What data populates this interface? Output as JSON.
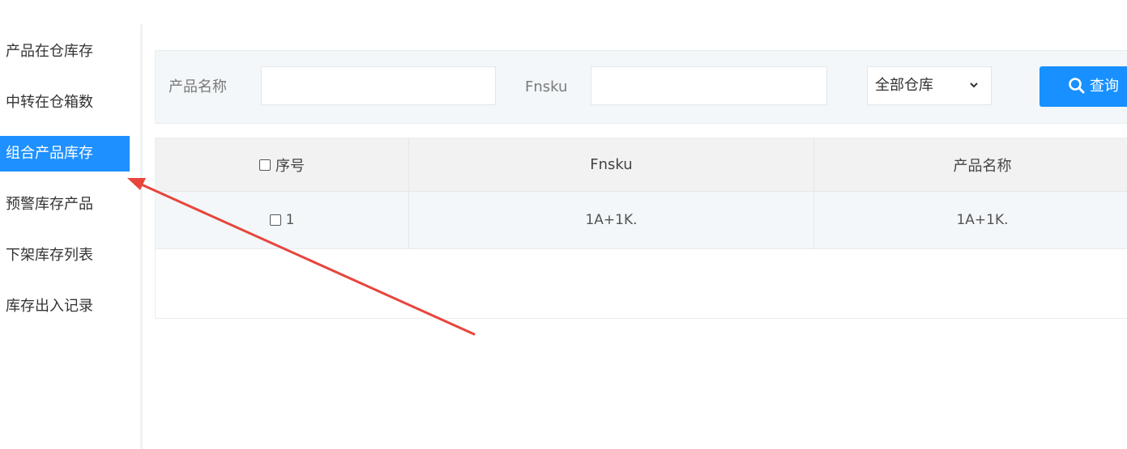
{
  "sidebar": {
    "items": [
      {
        "label": "产品在仓库存"
      },
      {
        "label": "中转在仓箱数"
      },
      {
        "label": "组合产品库存"
      },
      {
        "label": "预警库存产品"
      },
      {
        "label": "下架库存列表"
      },
      {
        "label": "库存出入记录"
      }
    ],
    "active_index": 2
  },
  "search": {
    "product_name_label": "产品名称",
    "product_name_value": "",
    "fnsku_label": "Fnsku",
    "fnsku_value": "",
    "warehouse_selected": "全部仓库",
    "query_button_label": "查询"
  },
  "table": {
    "headers": [
      "序号",
      "Fnsku",
      "产品名称"
    ],
    "rows": [
      {
        "index": "1",
        "fnsku": "1A+1K.",
        "product_name": "1A+1K."
      }
    ]
  },
  "colors": {
    "accent": "#1890ff",
    "annotation_arrow": "#e8453c"
  },
  "icons": {
    "query": "search-icon",
    "select": "chevron-down-icon"
  }
}
